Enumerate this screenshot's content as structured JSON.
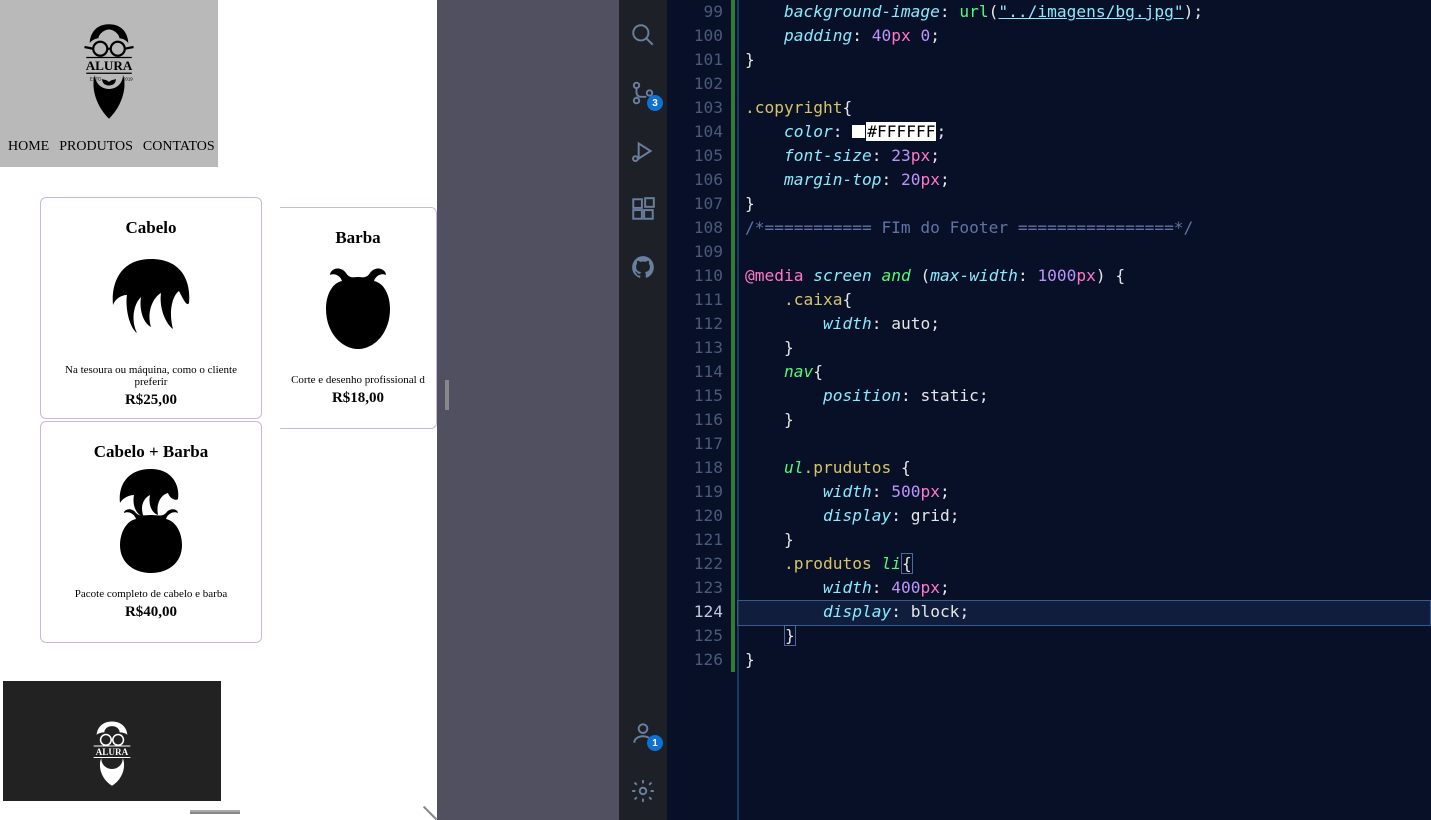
{
  "preview": {
    "logo_text": "ALURA",
    "nav": [
      "HOME",
      "PRODUTOS",
      "CONTATOS"
    ],
    "cards": [
      {
        "title": "Cabelo",
        "desc": "Na tesoura ou máquina, como o cliente preferir",
        "price": "R$25,00"
      },
      {
        "title": "Barba",
        "desc": "Corte e desenho profissional d",
        "price": "R$18,00"
      },
      {
        "title": "Cabelo + Barba",
        "desc": "Pacote completo de cabelo e barba",
        "price": "R$40,00"
      }
    ]
  },
  "activity": {
    "source_control_badge": "3",
    "accounts_badge": "1"
  },
  "editor": {
    "line_start": 99,
    "line_end": 126,
    "current_line": 124,
    "tokens": {
      "bg_image": "background-image",
      "bg_url": "\"../imagens/bg.jpg\"",
      "padding": "padding",
      "pad_val1": "40",
      "pad_val2": "0",
      "copyright": ".copyright",
      "color": "color",
      "color_val": "#FFFFFF",
      "font_size": "font-size",
      "fs_val": "23",
      "margin_top": "margin-top",
      "mt_val": "20",
      "comment": "/*=========== FIm do Footer ================*/",
      "at_media": "@media",
      "screen": "screen",
      "and": "and",
      "max_width": "max-width",
      "mw_val": "1000",
      "caixa": ".caixa",
      "width": "width",
      "auto": "auto",
      "nav_sel": "nav",
      "position": "position",
      "static": "static",
      "ul": "ul",
      "prudutos": ".prudutos",
      "w500": "500",
      "display": "display",
      "grid": "grid",
      "produtos": ".produtos",
      "li": "li",
      "w400": "400",
      "block": "block",
      "url_fn": "url",
      "px": "px"
    }
  }
}
